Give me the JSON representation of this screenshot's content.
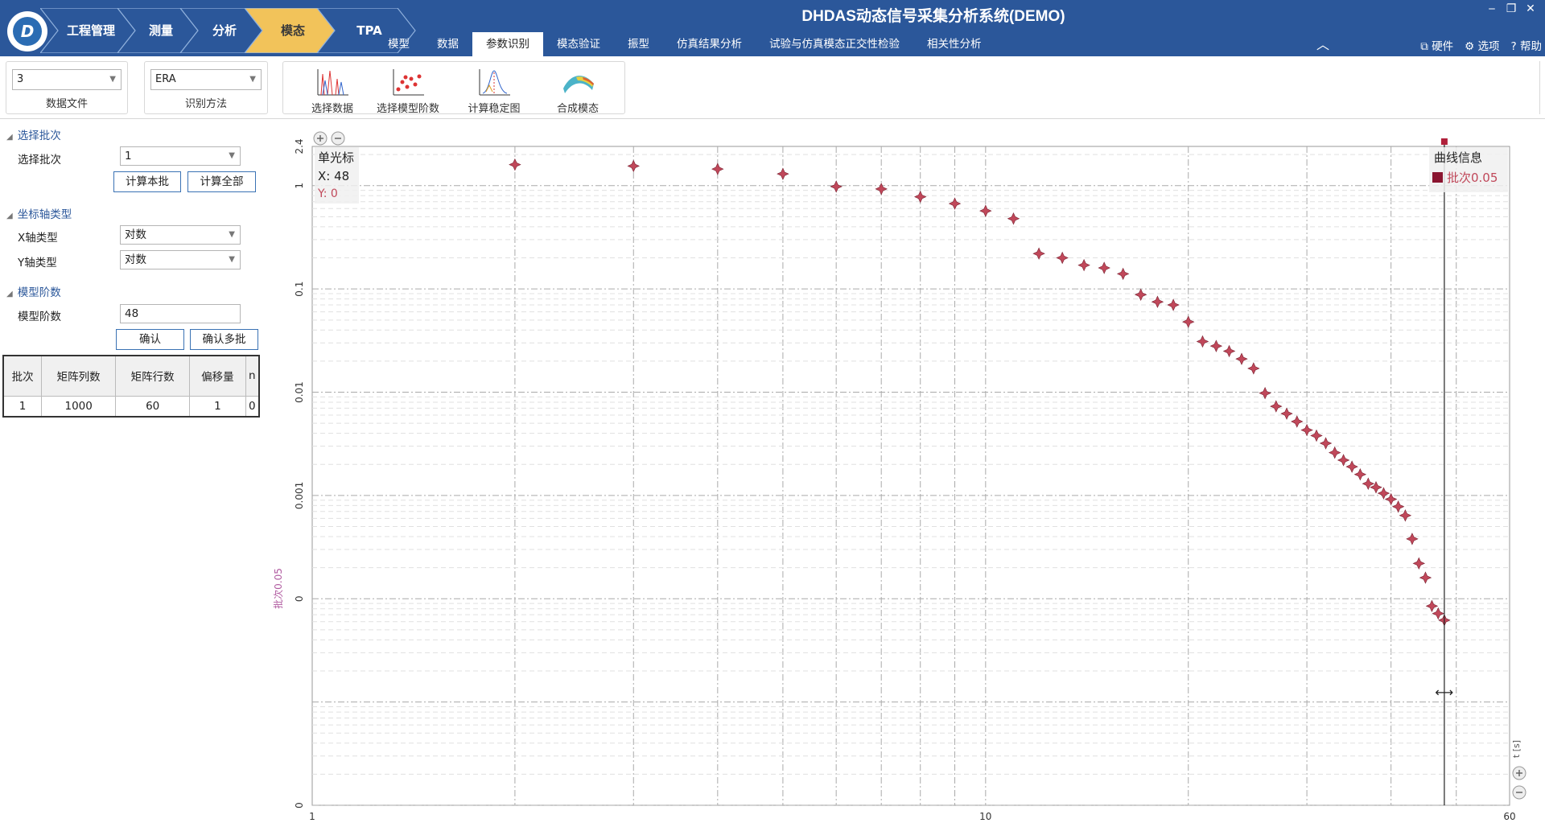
{
  "app": {
    "title": "DHDAS动态信号采集分析系统(DEMO)",
    "logo_letter": "D",
    "window_controls": [
      "‒",
      "❐",
      "✕"
    ]
  },
  "breadcrumb": [
    "工程管理",
    "测量",
    "分析",
    "模态",
    "TPA"
  ],
  "breadcrumb_active": 3,
  "ribbon_tabs": [
    "模型",
    "数据",
    "参数识别",
    "模态验证",
    "振型",
    "仿真结果分析",
    "试验与仿真模态正交性检验",
    "相关性分析"
  ],
  "ribbon_active": 2,
  "right_actions": {
    "hardware": "硬件",
    "options": "选项",
    "help": "帮助"
  },
  "toolbar": {
    "data_file": {
      "value": "3",
      "label": "数据文件"
    },
    "method": {
      "value": "ERA",
      "label": "识别方法"
    },
    "buttons": [
      {
        "label": "选择数据",
        "icon": "select-data-icon"
      },
      {
        "label": "选择模型阶数",
        "icon": "model-order-icon"
      },
      {
        "label": "计算稳定图",
        "icon": "stability-chart-icon"
      },
      {
        "label": "合成模态",
        "icon": "synthesize-mode-icon"
      }
    ],
    "active_button": 1
  },
  "panel": {
    "sec_batch": "选择批次",
    "batch_label": "选择批次",
    "batch_value": "1",
    "calc_this": "计算本批",
    "calc_all": "计算全部",
    "sec_axis": "坐标轴类型",
    "x_axis_label": "X轴类型",
    "x_axis_value": "对数",
    "y_axis_label": "Y轴类型",
    "y_axis_value": "对数",
    "sec_order": "模型阶数",
    "order_label": "模型阶数",
    "order_value": "48",
    "confirm": "确认",
    "confirm_multi": "确认多批",
    "table": {
      "headers": [
        "批次",
        "矩阵列数",
        "矩阵行数",
        "偏移量",
        "n"
      ],
      "rows": [
        [
          "1",
          "1000",
          "60",
          "1",
          "0"
        ]
      ]
    }
  },
  "chart_data": {
    "type": "scatter",
    "xscale": "log",
    "yscale": "log",
    "xlim": [
      1,
      60
    ],
    "ylim": [
      1e-06,
      2.4
    ],
    "x_ticks": [
      "1",
      "10",
      "60"
    ],
    "y_ticks": [
      "2.4",
      "1",
      "0.1",
      "0.01",
      "0.001",
      "0",
      "0"
    ],
    "ylabel": "批次0.05",
    "xlabel_side": "t [s]",
    "series": [
      {
        "name": "批次0.05",
        "color": "#c0485a"
      }
    ],
    "x": [
      2,
      3,
      4,
      5,
      6,
      7,
      8,
      9,
      10,
      11,
      12,
      13,
      14,
      15,
      16,
      17,
      18,
      19,
      20,
      21,
      22,
      23,
      24,
      25,
      26,
      27,
      28,
      29,
      30,
      31,
      32,
      33,
      34,
      35,
      36,
      37,
      38,
      39,
      40,
      41,
      42,
      43,
      44,
      45,
      46,
      47,
      48
    ],
    "y": [
      1.6,
      1.55,
      1.45,
      1.3,
      0.98,
      0.93,
      0.78,
      0.67,
      0.57,
      0.48,
      0.22,
      0.2,
      0.17,
      0.16,
      0.14,
      0.088,
      0.075,
      0.07,
      0.048,
      0.031,
      0.028,
      0.025,
      0.021,
      0.017,
      0.0098,
      0.0073,
      0.0062,
      0.0052,
      0.0043,
      0.0038,
      0.0032,
      0.0026,
      0.0022,
      0.0019,
      0.0016,
      0.0013,
      0.0012,
      0.00105,
      0.00092,
      0.00078,
      0.00064,
      0.00038,
      0.00022,
      0.00016,
      8.5e-05,
      7.2e-05,
      6.2e-05
    ],
    "cursor": {
      "title": "单光标",
      "x_text": "X: 48",
      "y_text": "Y: 0",
      "x": 48
    },
    "legend": {
      "title": "曲线信息",
      "entry": "批次0.05",
      "position": "top-right"
    },
    "grid": true
  },
  "colors": {
    "accent": "#2b579a",
    "marker": "#c0485a",
    "active_tool": "#fde98d"
  }
}
